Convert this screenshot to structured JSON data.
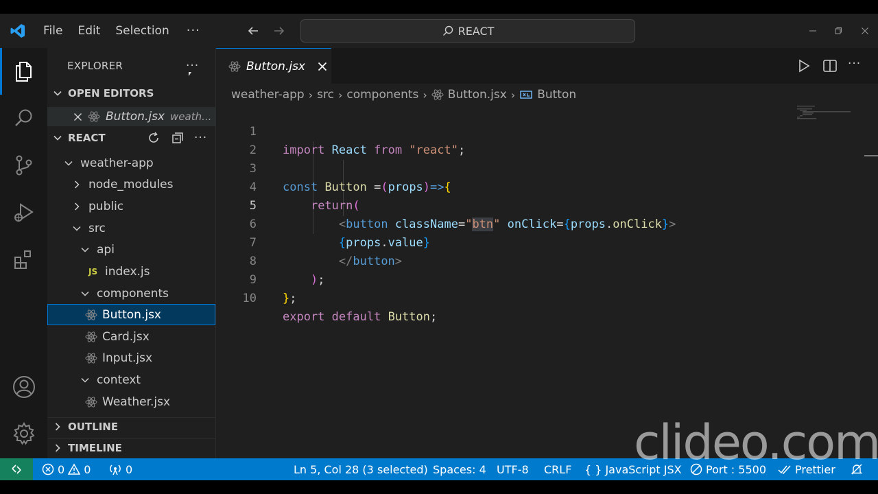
{
  "menu": {
    "file": "File",
    "edit": "Edit",
    "selection": "Selection",
    "more": "···"
  },
  "command_center": {
    "label": "REACT"
  },
  "explorer": {
    "title": "EXPLORER",
    "more": "···",
    "open_editors": {
      "header": "OPEN EDITORS",
      "item_name": "Button.jsx",
      "item_path": "weath..."
    },
    "react_header": "REACT",
    "tree": [
      {
        "label": "weather-app"
      },
      {
        "label": "node_modules"
      },
      {
        "label": "public"
      },
      {
        "label": "src"
      },
      {
        "label": "api"
      },
      {
        "label": "index.js",
        "badge": "JS"
      },
      {
        "label": "components"
      },
      {
        "label": "Button.jsx"
      },
      {
        "label": "Card.jsx"
      },
      {
        "label": "Input.jsx"
      },
      {
        "label": "context"
      },
      {
        "label": "Weather.jsx"
      }
    ],
    "outline": "OUTLINE",
    "timeline": "TIMELINE"
  },
  "editor": {
    "tab": {
      "label": "Button.jsx"
    },
    "breadcrumb": [
      "weather-app",
      "src",
      "components",
      "Button.jsx",
      "Button"
    ],
    "line_numbers": [
      "1",
      "2",
      "3",
      "4",
      "5",
      "6",
      "7",
      "8",
      "9",
      "10"
    ]
  },
  "status": {
    "errors": "0",
    "warnings": "0",
    "ports": "0",
    "cursor": "Ln 5, Col 28 (3 selected)",
    "spaces": "Spaces: 4",
    "encoding": "UTF-8",
    "eol": "CRLF",
    "language": "JavaScript JSX",
    "port": "Port : 5500",
    "prettier": "Prettier"
  },
  "watermark": "clideo.com",
  "colors": {
    "accent": "#0078d4",
    "statusbar": "#007acc",
    "remote": "#16825d"
  }
}
